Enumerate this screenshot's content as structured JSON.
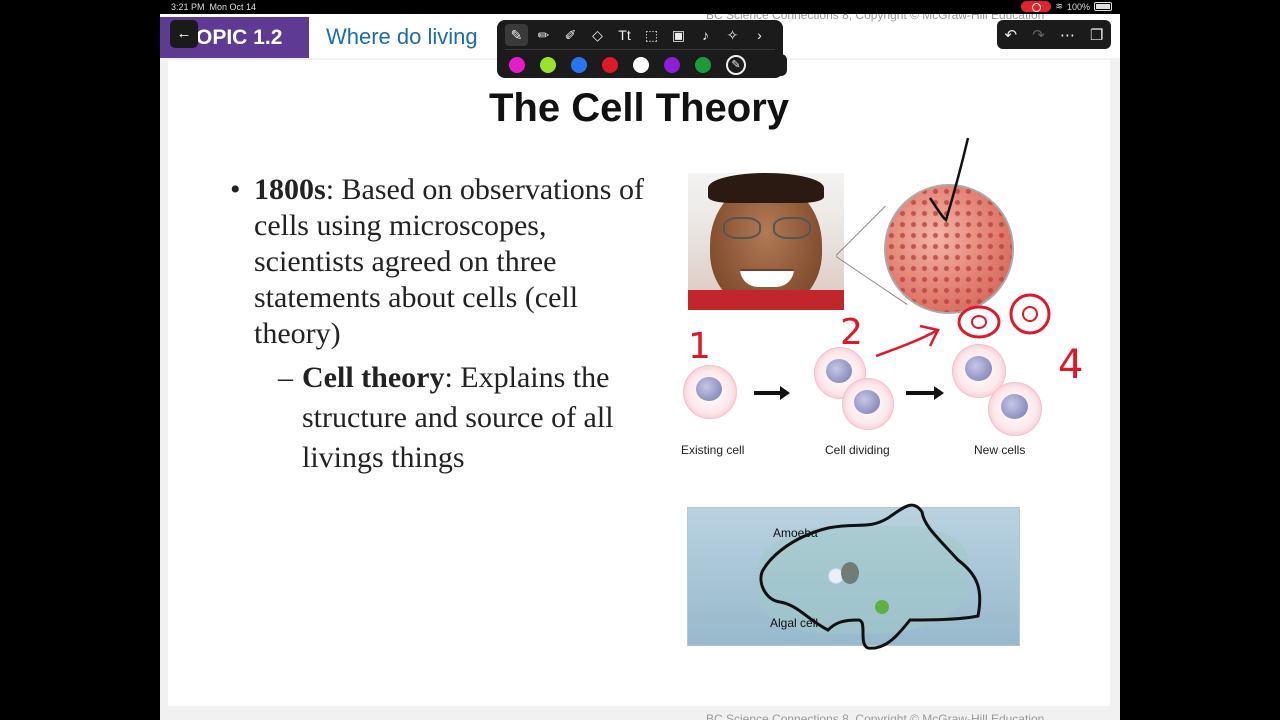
{
  "status_bar": {
    "time": "3:21 PM",
    "date": "Mon Oct 14",
    "battery": "100%",
    "record_color": "#e0242b"
  },
  "header": {
    "topic_label": "OPIC 1.2",
    "section_title": "Where do living",
    "copyright_top": "BC Science Connections 8, Copyright © McGraw-Hill Education",
    "topic_color": "#5e3a93",
    "title_color": "#1d6cae"
  },
  "slide": {
    "title": "The Cell Theory",
    "bullet": {
      "bold": "1800s",
      "text": ": Based on observations of cells using microscopes, scientists agreed on three statements about cells (cell theory)"
    },
    "sub_bullet": {
      "bold": "Cell theory",
      "text": ": Explains the structure and source of all livings things"
    },
    "figure_labels": {
      "existing": "Existing cell",
      "dividing": "Cell dividing",
      "new": "New cells",
      "amoeba": "Amoeba",
      "algal": "Algal cell"
    },
    "ink_annotations": [
      "1",
      "2",
      "4"
    ],
    "footer_copyright": "BC Science Connections 8, Copyright © McGraw-Hill Education"
  },
  "toolbar": {
    "tools": [
      "pen-icon",
      "pencil-icon",
      "marker-icon",
      "eraser-icon",
      "text-icon",
      "lasso-icon",
      "image-icon",
      "microphone-icon",
      "magic-pen-icon",
      "chevron-right-icon"
    ],
    "colors": [
      "#e51ccb",
      "#9be22b",
      "#2a74f0",
      "#e0182a",
      "#ffffff",
      "#8a1fd6",
      "#1f9a3a"
    ]
  },
  "undo_bar": {
    "icons": [
      "undo-icon",
      "redo-icon",
      "more-icon",
      "pages-icon"
    ]
  }
}
